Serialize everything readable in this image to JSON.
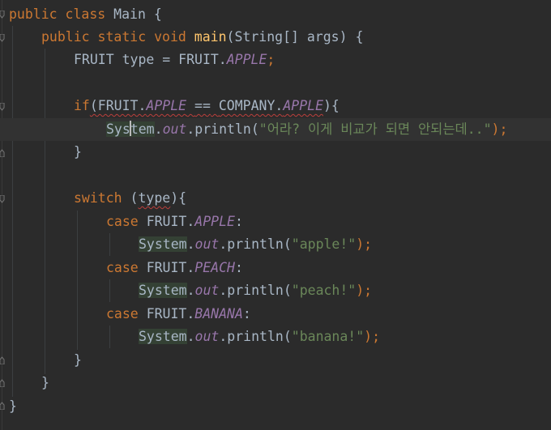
{
  "editor": {
    "lines": [
      {
        "tokens": [
          "public",
          "class",
          "Main",
          "{"
        ]
      },
      {
        "tokens": [
          "public",
          "static",
          "void",
          "main",
          "(String[] args) {"
        ]
      },
      {
        "tokens": [
          "FRUIT type = FRUIT.",
          "APPLE",
          ";"
        ]
      },
      {
        "tokens": []
      },
      {
        "tokens": [
          "if",
          "(FRUIT.",
          "APPLE",
          "==",
          "COMPANY.",
          "APPLE",
          "){"
        ]
      },
      {
        "tokens": [
          "Sys",
          "tem",
          ".",
          "out",
          ".println(",
          "\"어라? 이게 비교가 되면 안되는데..\"",
          ");"
        ]
      },
      {
        "tokens": [
          "}"
        ]
      },
      {
        "tokens": []
      },
      {
        "tokens": [
          "switch",
          "(",
          "type",
          "){"
        ]
      },
      {
        "tokens": [
          "case",
          "FRUIT.",
          "APPLE",
          ":"
        ]
      },
      {
        "tokens": [
          "System",
          ".",
          "out",
          ".println(",
          "\"apple!\"",
          ");"
        ]
      },
      {
        "tokens": [
          "case",
          "FRUIT.",
          "PEACH",
          ":"
        ]
      },
      {
        "tokens": [
          "System",
          ".",
          "out",
          ".println(",
          "\"peach!\"",
          ");"
        ]
      },
      {
        "tokens": [
          "case",
          "FRUIT.",
          "BANANA",
          ":"
        ]
      },
      {
        "tokens": [
          "System",
          ".",
          "out",
          ".println(",
          "\"banana!\"",
          ");"
        ]
      },
      {
        "tokens": [
          "}"
        ]
      },
      {
        "tokens": [
          "}"
        ]
      },
      {
        "tokens": [
          "}"
        ]
      }
    ]
  },
  "colors": {
    "background": "#2b2b2b",
    "keyword": "#cc7832",
    "method_decl": "#ffc66d",
    "constant": "#9876aa",
    "string": "#6a8759",
    "default_text": "#a9b7c6",
    "error_underline": "#bc3f3c"
  },
  "icons": [
    "fold-marker-icon",
    "text-caret-icon"
  ]
}
